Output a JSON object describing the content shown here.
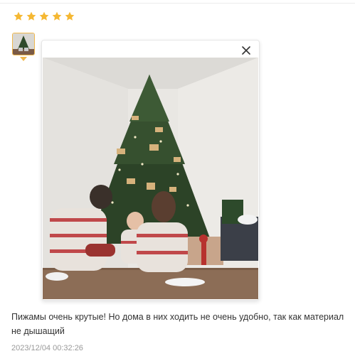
{
  "review": {
    "rating": 5,
    "stars_color": "#f5b833",
    "text": "Пижамы очень крутые! Но дома в них ходить не очень удобно, так как материал не дышащий",
    "date": "2023/12/04 00:32:26"
  },
  "thumbnail": {
    "selected_border_color": "#f0b84d"
  },
  "preview": {
    "close_icon": "close-icon"
  }
}
